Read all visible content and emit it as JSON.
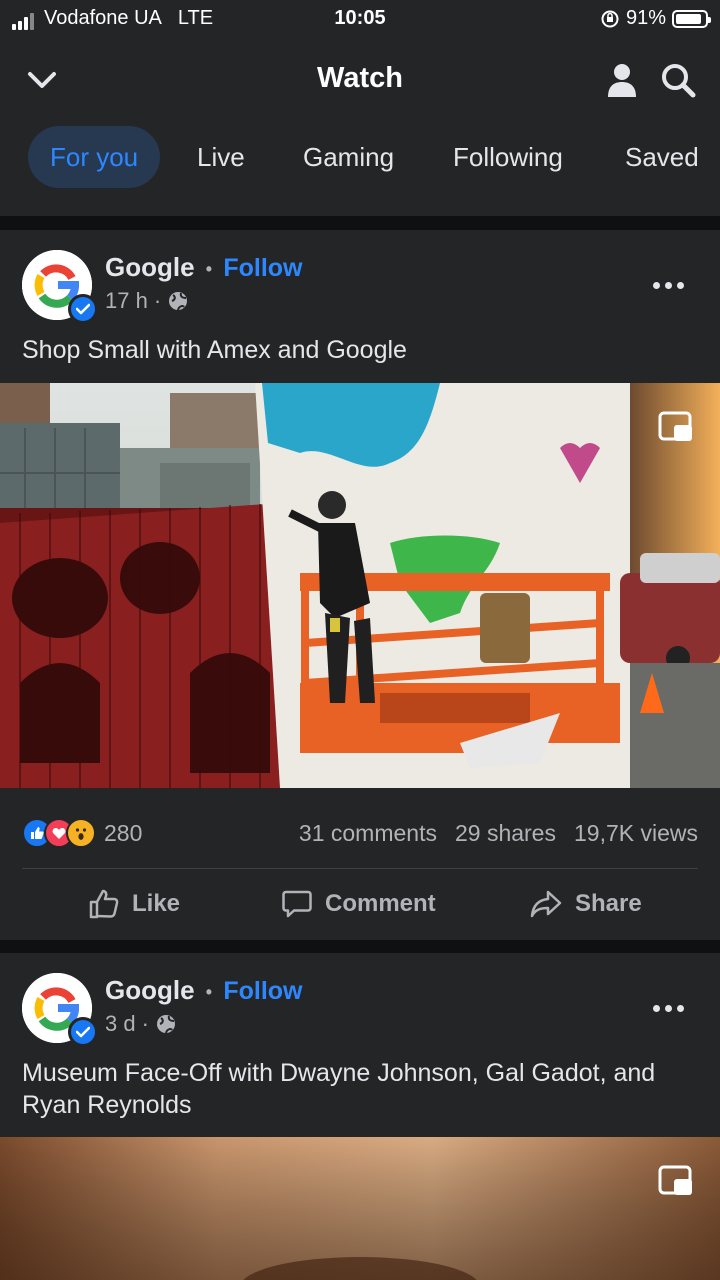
{
  "status_bar": {
    "carrier": "Vodafone UA",
    "network": "LTE",
    "time": "10:05",
    "battery": "91%",
    "battery_level": 0.91
  },
  "header": {
    "title": "Watch",
    "back_icon": "chevron-down-icon",
    "profile_icon": "person-icon",
    "search_icon": "search-icon"
  },
  "tabs": [
    {
      "label": "For you",
      "active": true
    },
    {
      "label": "Live"
    },
    {
      "label": "Gaming"
    },
    {
      "label": "Following"
    },
    {
      "label": "Saved"
    }
  ],
  "posts": [
    {
      "author": "Google",
      "separator": "•",
      "follow_label": "Follow",
      "time": "17 h",
      "meta_sep": "·",
      "caption": "Shop Small with Amex and Google",
      "stats": {
        "reactions_count": "280",
        "comments": "31 comments",
        "shares": "29 shares",
        "views": "19,7K views"
      },
      "actions": {
        "like": "Like",
        "comment": "Comment",
        "share": "Share"
      }
    },
    {
      "author": "Google",
      "separator": "•",
      "follow_label": "Follow",
      "time": "3 d",
      "meta_sep": "·",
      "caption": "Museum Face-Off with Dwayne Johnson, Gal Gadot, and Ryan Reynolds"
    }
  ],
  "colors": {
    "accent": "#2d88ff",
    "background": "#18191a",
    "surface": "#242526"
  }
}
